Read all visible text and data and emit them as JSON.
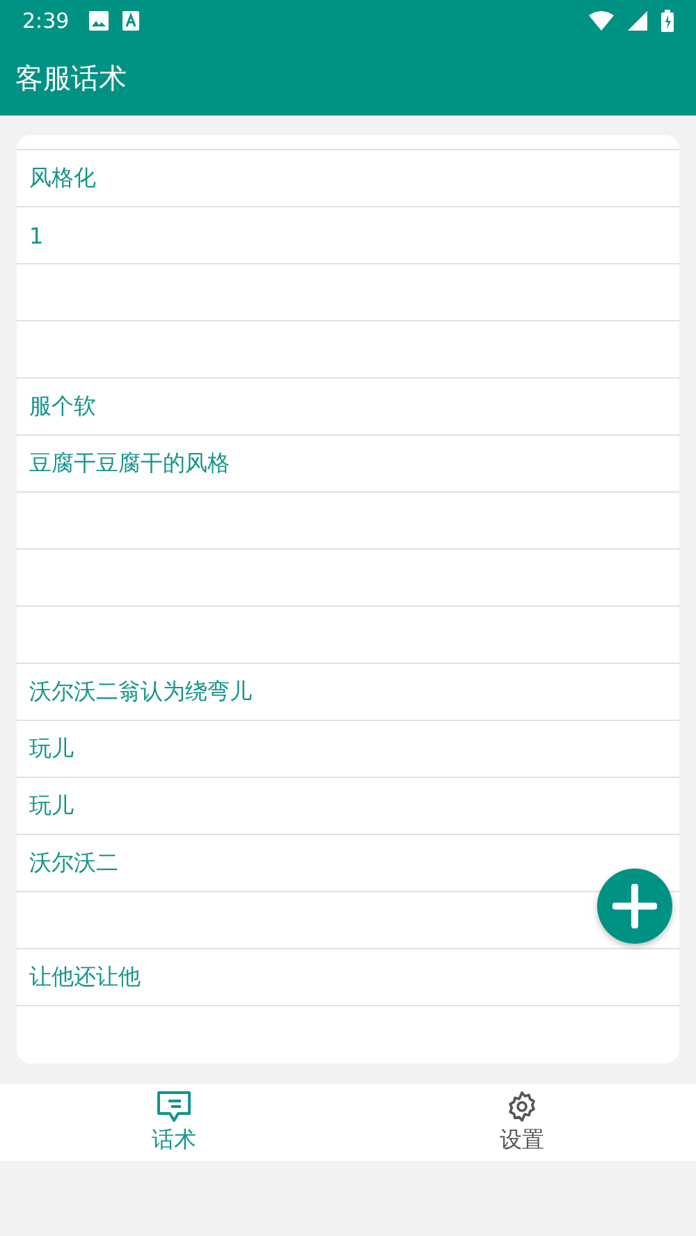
{
  "status_bar": {
    "time": "2:39"
  },
  "app_bar": {
    "title": "客服话术"
  },
  "scripts": [
    {
      "kind": "text",
      "text": "风格化"
    },
    {
      "kind": "text",
      "text": "1"
    },
    {
      "kind": "blank"
    },
    {
      "kind": "blank"
    },
    {
      "kind": "text",
      "text": "服个软"
    },
    {
      "kind": "text",
      "text": "豆腐干豆腐干的风格"
    },
    {
      "kind": "blank"
    },
    {
      "kind": "blank"
    },
    {
      "kind": "blank"
    },
    {
      "kind": "text",
      "text": "沃尔沃二翁认为绕弯儿"
    },
    {
      "kind": "text",
      "text": "玩儿"
    },
    {
      "kind": "text",
      "text": "玩儿"
    },
    {
      "kind": "text",
      "text": "沃尔沃二"
    },
    {
      "kind": "blank"
    },
    {
      "kind": "text",
      "text": "让他还让他"
    },
    {
      "kind": "blank"
    }
  ],
  "bottom_nav": [
    {
      "label": "话术",
      "kind": "chat",
      "selected": true
    },
    {
      "label": "设置",
      "kind": "gear",
      "selected": false
    }
  ]
}
